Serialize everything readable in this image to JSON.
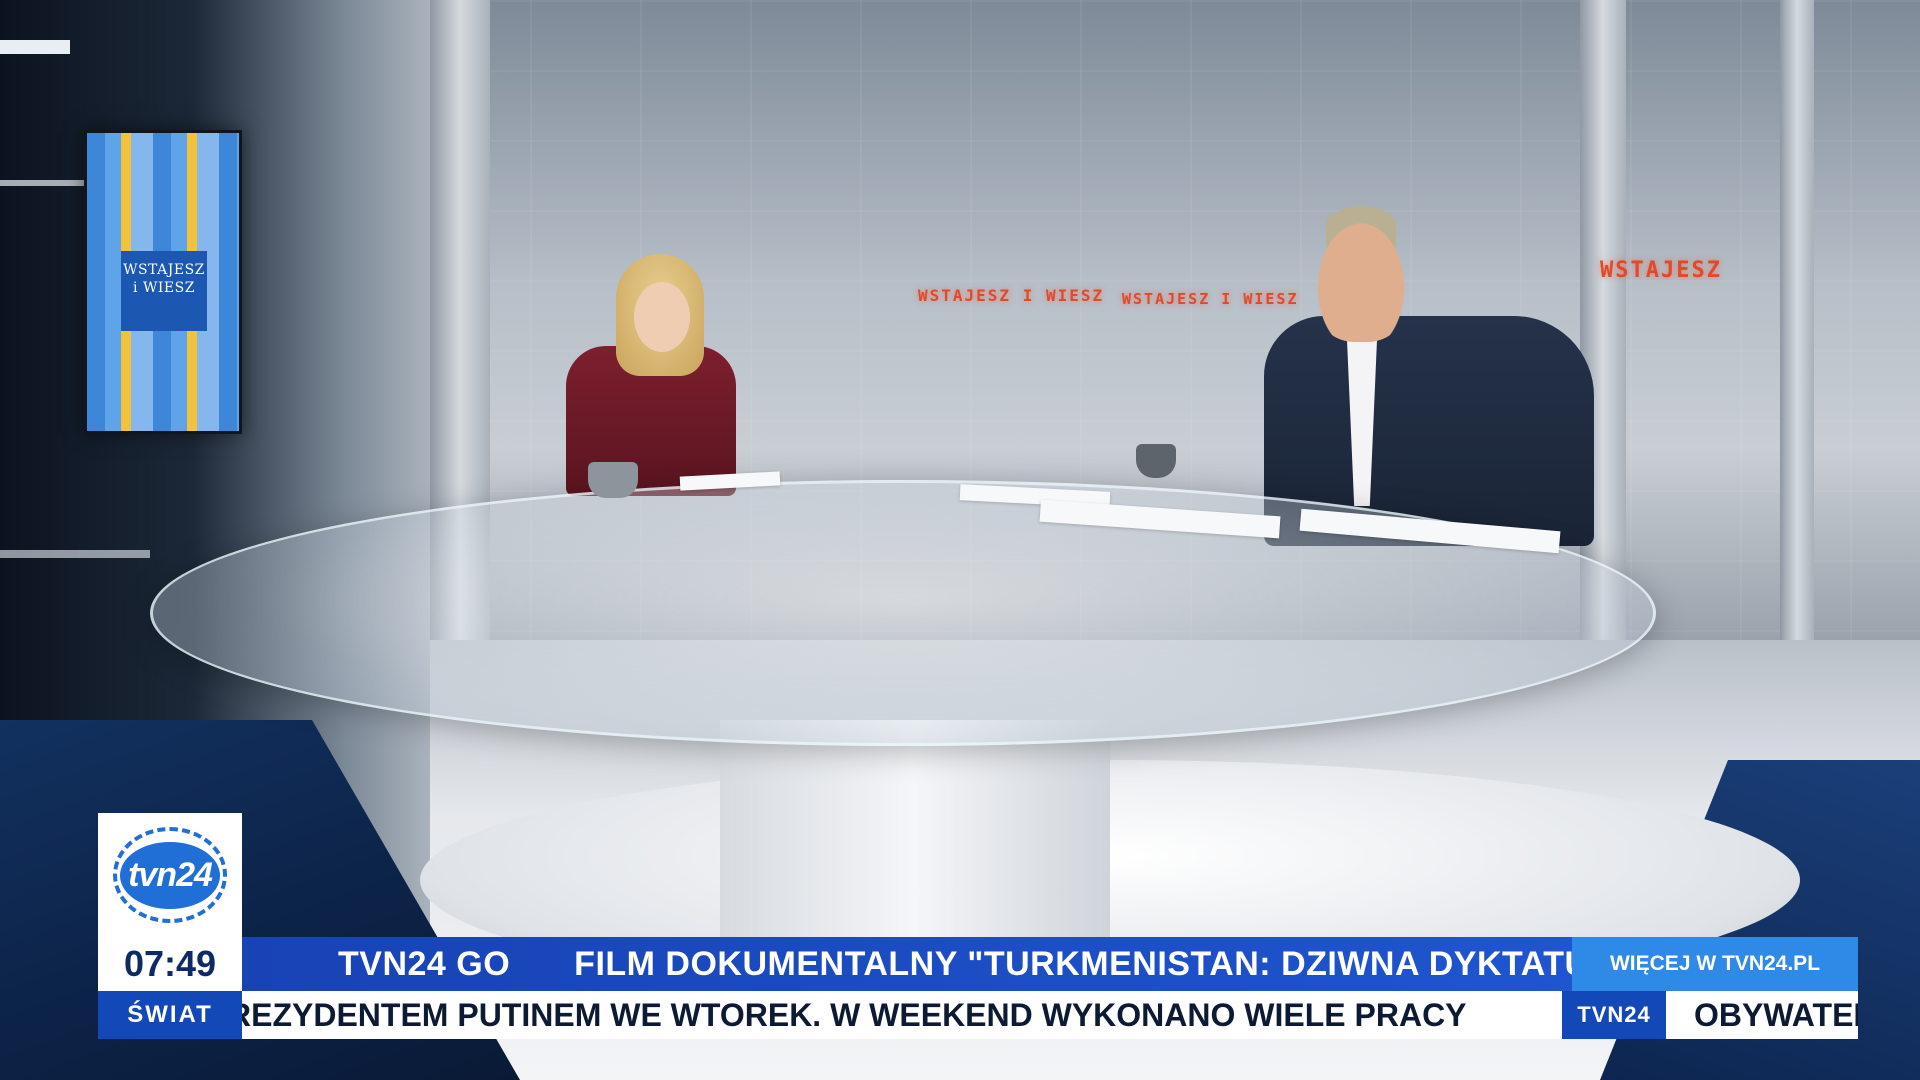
{
  "studio": {
    "screen_label_line1": "WSTAJESZ",
    "screen_label_line2": "i WIESZ",
    "sign_1": "WSTAJESZ I WIESZ",
    "sign_2": "WSTAJESZ I WIESZ",
    "sign_3": "WSTAJESZ"
  },
  "logo": {
    "text": "tvn24"
  },
  "clock": {
    "time": "07:49"
  },
  "section": {
    "label": "ŚWIAT"
  },
  "headline": {
    "tag": "TVN24 GO",
    "text": "FILM DOKUMENTALNY  \"TURKMENISTAN: DZIWNA DYKTATURA\""
  },
  "more": {
    "label": "WIĘCEJ W TVN24.PL"
  },
  "crawl": {
    "text": "REZYDENTEM PUTINEM WE WTOREK. W WEEKEND WYKONANO WIELE PRACY",
    "brand": "TVN24",
    "next_text": "OBYWATEL"
  },
  "colors": {
    "primary_blue": "#1348b8",
    "headline_blue": "#1f55cf",
    "more_blue": "#2e8ae6",
    "crawl_bg": "#ffffff"
  }
}
